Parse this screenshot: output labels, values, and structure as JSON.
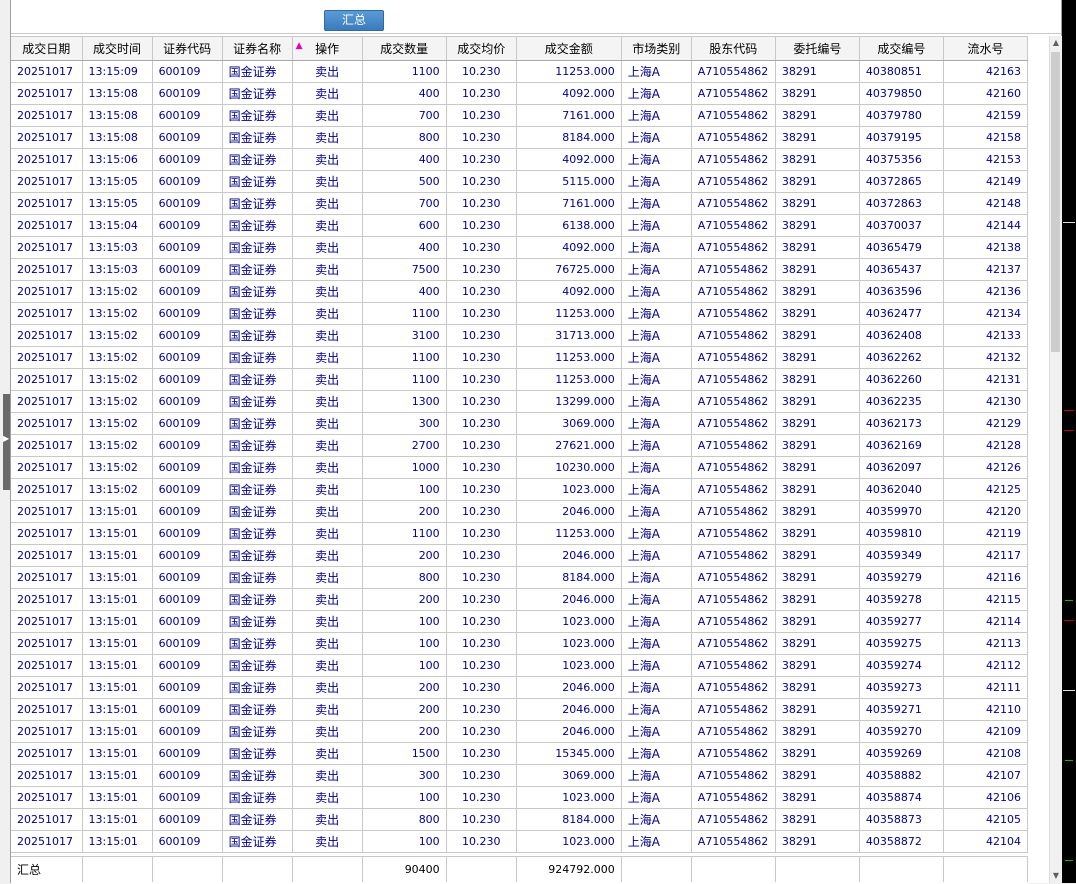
{
  "toolbar": {
    "summary_button": "汇总"
  },
  "columns": [
    "成交日期",
    "成交时间",
    "证券代码",
    "证券名称",
    "操作",
    "成交数量",
    "成交均价",
    "成交金额",
    "市场类别",
    "股东代码",
    "委托编号",
    "成交编号",
    "流水号"
  ],
  "sort_indicator": "▲",
  "rows": [
    [
      "20251017",
      "13:15:09",
      "600109",
      "国金证券",
      "卖出",
      "1100",
      "10.230",
      "11253.000",
      "上海A",
      "A710554862",
      "38291",
      "40380851",
      "42163"
    ],
    [
      "20251017",
      "13:15:08",
      "600109",
      "国金证券",
      "卖出",
      "400",
      "10.230",
      "4092.000",
      "上海A",
      "A710554862",
      "38291",
      "40379850",
      "42160"
    ],
    [
      "20251017",
      "13:15:08",
      "600109",
      "国金证券",
      "卖出",
      "700",
      "10.230",
      "7161.000",
      "上海A",
      "A710554862",
      "38291",
      "40379780",
      "42159"
    ],
    [
      "20251017",
      "13:15:08",
      "600109",
      "国金证券",
      "卖出",
      "800",
      "10.230",
      "8184.000",
      "上海A",
      "A710554862",
      "38291",
      "40379195",
      "42158"
    ],
    [
      "20251017",
      "13:15:06",
      "600109",
      "国金证券",
      "卖出",
      "400",
      "10.230",
      "4092.000",
      "上海A",
      "A710554862",
      "38291",
      "40375356",
      "42153"
    ],
    [
      "20251017",
      "13:15:05",
      "600109",
      "国金证券",
      "卖出",
      "500",
      "10.230",
      "5115.000",
      "上海A",
      "A710554862",
      "38291",
      "40372865",
      "42149"
    ],
    [
      "20251017",
      "13:15:05",
      "600109",
      "国金证券",
      "卖出",
      "700",
      "10.230",
      "7161.000",
      "上海A",
      "A710554862",
      "38291",
      "40372863",
      "42148"
    ],
    [
      "20251017",
      "13:15:04",
      "600109",
      "国金证券",
      "卖出",
      "600",
      "10.230",
      "6138.000",
      "上海A",
      "A710554862",
      "38291",
      "40370037",
      "42144"
    ],
    [
      "20251017",
      "13:15:03",
      "600109",
      "国金证券",
      "卖出",
      "400",
      "10.230",
      "4092.000",
      "上海A",
      "A710554862",
      "38291",
      "40365479",
      "42138"
    ],
    [
      "20251017",
      "13:15:03",
      "600109",
      "国金证券",
      "卖出",
      "7500",
      "10.230",
      "76725.000",
      "上海A",
      "A710554862",
      "38291",
      "40365437",
      "42137"
    ],
    [
      "20251017",
      "13:15:02",
      "600109",
      "国金证券",
      "卖出",
      "400",
      "10.230",
      "4092.000",
      "上海A",
      "A710554862",
      "38291",
      "40363596",
      "42136"
    ],
    [
      "20251017",
      "13:15:02",
      "600109",
      "国金证券",
      "卖出",
      "1100",
      "10.230",
      "11253.000",
      "上海A",
      "A710554862",
      "38291",
      "40362477",
      "42134"
    ],
    [
      "20251017",
      "13:15:02",
      "600109",
      "国金证券",
      "卖出",
      "3100",
      "10.230",
      "31713.000",
      "上海A",
      "A710554862",
      "38291",
      "40362408",
      "42133"
    ],
    [
      "20251017",
      "13:15:02",
      "600109",
      "国金证券",
      "卖出",
      "1100",
      "10.230",
      "11253.000",
      "上海A",
      "A710554862",
      "38291",
      "40362262",
      "42132"
    ],
    [
      "20251017",
      "13:15:02",
      "600109",
      "国金证券",
      "卖出",
      "1100",
      "10.230",
      "11253.000",
      "上海A",
      "A710554862",
      "38291",
      "40362260",
      "42131"
    ],
    [
      "20251017",
      "13:15:02",
      "600109",
      "国金证券",
      "卖出",
      "1300",
      "10.230",
      "13299.000",
      "上海A",
      "A710554862",
      "38291",
      "40362235",
      "42130"
    ],
    [
      "20251017",
      "13:15:02",
      "600109",
      "国金证券",
      "卖出",
      "300",
      "10.230",
      "3069.000",
      "上海A",
      "A710554862",
      "38291",
      "40362173",
      "42129"
    ],
    [
      "20251017",
      "13:15:02",
      "600109",
      "国金证券",
      "卖出",
      "2700",
      "10.230",
      "27621.000",
      "上海A",
      "A710554862",
      "38291",
      "40362169",
      "42128"
    ],
    [
      "20251017",
      "13:15:02",
      "600109",
      "国金证券",
      "卖出",
      "1000",
      "10.230",
      "10230.000",
      "上海A",
      "A710554862",
      "38291",
      "40362097",
      "42126"
    ],
    [
      "20251017",
      "13:15:02",
      "600109",
      "国金证券",
      "卖出",
      "100",
      "10.230",
      "1023.000",
      "上海A",
      "A710554862",
      "38291",
      "40362040",
      "42125"
    ],
    [
      "20251017",
      "13:15:01",
      "600109",
      "国金证券",
      "卖出",
      "200",
      "10.230",
      "2046.000",
      "上海A",
      "A710554862",
      "38291",
      "40359970",
      "42120"
    ],
    [
      "20251017",
      "13:15:01",
      "600109",
      "国金证券",
      "卖出",
      "1100",
      "10.230",
      "11253.000",
      "上海A",
      "A710554862",
      "38291",
      "40359810",
      "42119"
    ],
    [
      "20251017",
      "13:15:01",
      "600109",
      "国金证券",
      "卖出",
      "200",
      "10.230",
      "2046.000",
      "上海A",
      "A710554862",
      "38291",
      "40359349",
      "42117"
    ],
    [
      "20251017",
      "13:15:01",
      "600109",
      "国金证券",
      "卖出",
      "800",
      "10.230",
      "8184.000",
      "上海A",
      "A710554862",
      "38291",
      "40359279",
      "42116"
    ],
    [
      "20251017",
      "13:15:01",
      "600109",
      "国金证券",
      "卖出",
      "200",
      "10.230",
      "2046.000",
      "上海A",
      "A710554862",
      "38291",
      "40359278",
      "42115"
    ],
    [
      "20251017",
      "13:15:01",
      "600109",
      "国金证券",
      "卖出",
      "100",
      "10.230",
      "1023.000",
      "上海A",
      "A710554862",
      "38291",
      "40359277",
      "42114"
    ],
    [
      "20251017",
      "13:15:01",
      "600109",
      "国金证券",
      "卖出",
      "100",
      "10.230",
      "1023.000",
      "上海A",
      "A710554862",
      "38291",
      "40359275",
      "42113"
    ],
    [
      "20251017",
      "13:15:01",
      "600109",
      "国金证券",
      "卖出",
      "100",
      "10.230",
      "1023.000",
      "上海A",
      "A710554862",
      "38291",
      "40359274",
      "42112"
    ],
    [
      "20251017",
      "13:15:01",
      "600109",
      "国金证券",
      "卖出",
      "200",
      "10.230",
      "2046.000",
      "上海A",
      "A710554862",
      "38291",
      "40359273",
      "42111"
    ],
    [
      "20251017",
      "13:15:01",
      "600109",
      "国金证券",
      "卖出",
      "200",
      "10.230",
      "2046.000",
      "上海A",
      "A710554862",
      "38291",
      "40359271",
      "42110"
    ],
    [
      "20251017",
      "13:15:01",
      "600109",
      "国金证券",
      "卖出",
      "200",
      "10.230",
      "2046.000",
      "上海A",
      "A710554862",
      "38291",
      "40359270",
      "42109"
    ],
    [
      "20251017",
      "13:15:01",
      "600109",
      "国金证券",
      "卖出",
      "1500",
      "10.230",
      "15345.000",
      "上海A",
      "A710554862",
      "38291",
      "40359269",
      "42108"
    ],
    [
      "20251017",
      "13:15:01",
      "600109",
      "国金证券",
      "卖出",
      "300",
      "10.230",
      "3069.000",
      "上海A",
      "A710554862",
      "38291",
      "40358882",
      "42107"
    ],
    [
      "20251017",
      "13:15:01",
      "600109",
      "国金证券",
      "卖出",
      "100",
      "10.230",
      "1023.000",
      "上海A",
      "A710554862",
      "38291",
      "40358874",
      "42106"
    ],
    [
      "20251017",
      "13:15:01",
      "600109",
      "国金证券",
      "卖出",
      "800",
      "10.230",
      "8184.000",
      "上海A",
      "A710554862",
      "38291",
      "40358873",
      "42105"
    ],
    [
      "20251017",
      "13:15:01",
      "600109",
      "国金证券",
      "卖出",
      "100",
      "10.230",
      "1023.000",
      "上海A",
      "A710554862",
      "38291",
      "40358872",
      "42104"
    ]
  ],
  "footer": {
    "label": "汇总",
    "total_quantity": "90400",
    "total_amount": "924792.000"
  },
  "colors": {
    "text": "#00008b",
    "header_bg": "#f4f4f4",
    "grid_line": "#c8c8c8",
    "button_bg": "#3a7bbd",
    "sort_indicator": "#e000c0"
  }
}
